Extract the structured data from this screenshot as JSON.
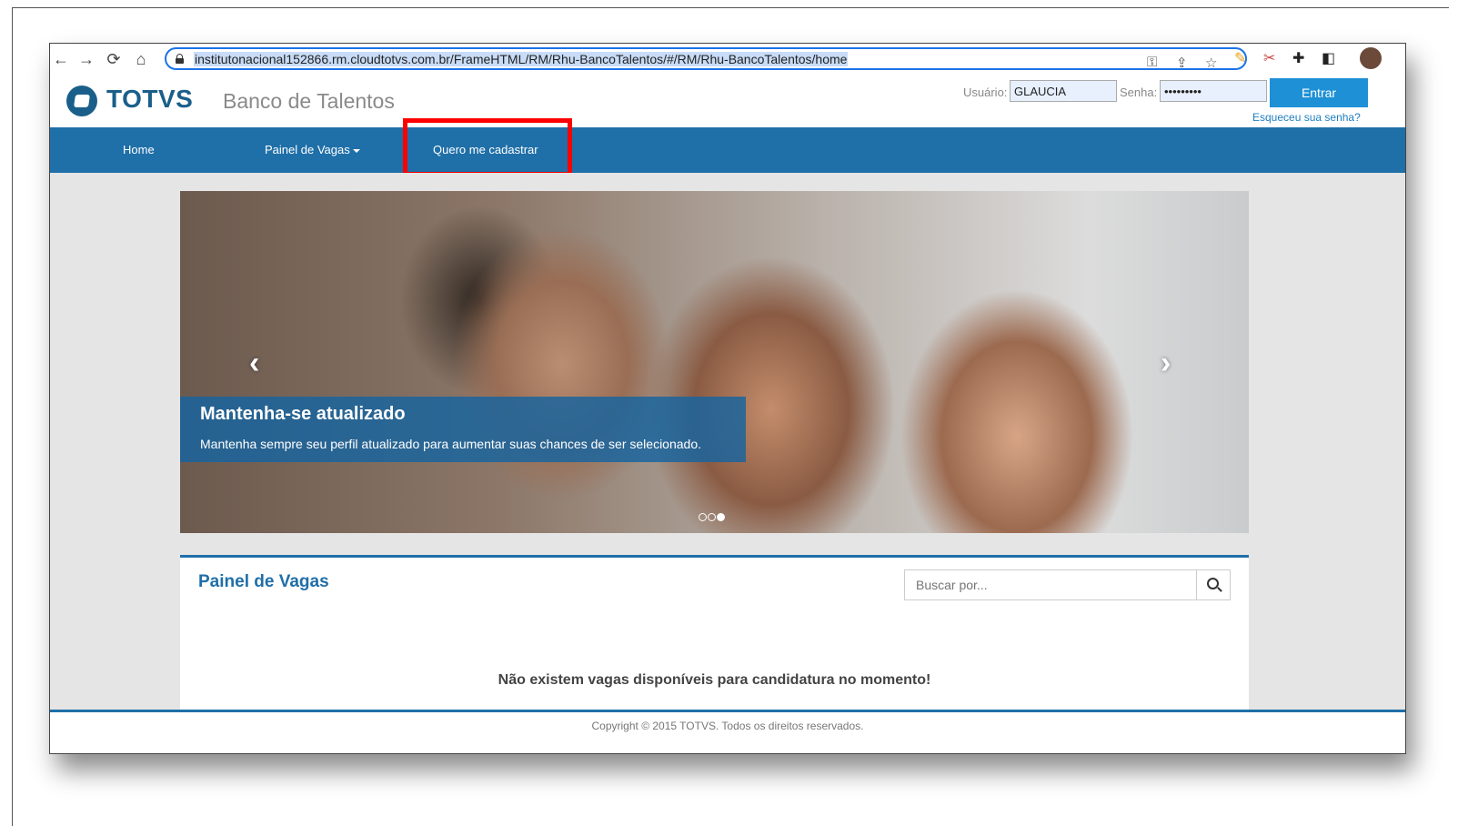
{
  "browser": {
    "url": "institutonacional152866.rm.cloudtotvs.com.br/FrameHTML/RM/Rhu-BancoTalentos/#/RM/Rhu-BancoTalentos/home",
    "icons": [
      "back-icon",
      "forward-icon",
      "reload-icon",
      "home-icon",
      "lock-icon",
      "key-icon",
      "share-icon",
      "star-icon",
      "extensions-icon",
      "sidepanel-icon",
      "profile-avatar"
    ]
  },
  "header": {
    "logo_text": "TOTVS",
    "site_title": "Banco de Talentos",
    "user_label": "Usuário:",
    "user_value": "GLAUCIA",
    "password_label": "Senha:",
    "password_value": "•••••••••",
    "login_button": "Entrar",
    "forgot_link": "Esqueceu sua senha?"
  },
  "nav": {
    "items": [
      {
        "label": "Home"
      },
      {
        "label": "Painel de Vagas"
      },
      {
        "label": "Quero me cadastrar"
      }
    ],
    "highlight_color": "#ff0000"
  },
  "carousel": {
    "caption_title": "Mantenha-se atualizado",
    "caption_text": "Mantenha sempre seu perfil atualizado para aumentar suas chances de ser selecionado.",
    "slide_count": 3,
    "active_slide": 3
  },
  "panel": {
    "title": "Painel de Vagas",
    "search_placeholder": "Buscar por...",
    "empty_message": "Não existem vagas disponíveis para candidatura no momento!"
  },
  "footer": {
    "text": "Copyright © 2015 TOTVS. Todos os direitos reservados."
  },
  "colors": {
    "brand": "#1f6fa8",
    "button": "#1e90d5"
  }
}
